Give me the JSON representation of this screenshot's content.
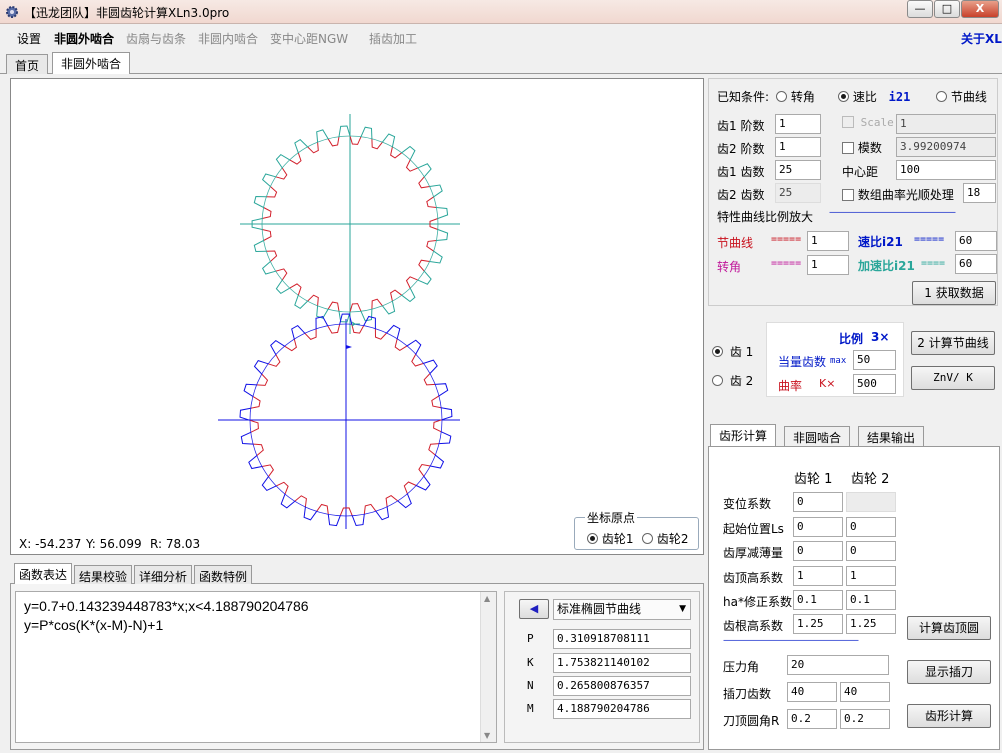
{
  "window": {
    "title": "【迅龙团队】非圆齿轮计算XLn3.0pro",
    "minimize": "—",
    "maximize": "□",
    "close": "X"
  },
  "menu": {
    "items": [
      "设置",
      "非圆外啮合",
      "齿扇与齿条",
      "非圆内啮合",
      "变中心距NGW",
      "插齿加工"
    ],
    "about": "关于XL"
  },
  "tabs": [
    "首页",
    "非圆外啮合"
  ],
  "canvas": {
    "x_label": "X: -54.237",
    "y_label": "Y: 56.099",
    "r_label": "R: 78.03",
    "origin_title": "坐标原点",
    "origin_gear1": "齿轮1",
    "origin_gear2": "齿轮2",
    "gear1_color": "#2aa69a",
    "gear2_color": "#1010e6",
    "flank_color": "#d2202c"
  },
  "known": {
    "label": "已知条件:",
    "opt_angle": "转角",
    "opt_speed": "速比",
    "speed_tag": "i21",
    "opt_pitch": "节曲线"
  },
  "params": {
    "g1_order_label": "齿1 阶数",
    "g1_order": "1",
    "g2_order_label": "齿2 阶数",
    "g2_order": "1",
    "g1_teeth_label": "齿1 齿数",
    "g1_teeth": "25",
    "g2_teeth_label": "齿2 齿数",
    "g2_teeth": "25",
    "scale_label": "Scale",
    "scale": "1",
    "module_label": "模数",
    "module": "3.99200974",
    "center_label": "中心距",
    "center": "100",
    "smooth_label": "数组曲率光顺处理",
    "smooth": "18"
  },
  "curve_scale": {
    "title": "特性曲线比例放大",
    "dashes": "——————————————",
    "pitch_label": "节曲线",
    "pitch_eq": "=====",
    "pitch_val": "1",
    "speed_label": "速比i21",
    "speed_eq": "=====",
    "speed_val": "60",
    "angle_label": "转角",
    "angle_eq": "=====",
    "angle_val": "1",
    "accel_label": "加速比i21",
    "accel_eq": "====",
    "accel_val": "60",
    "get_data_btn": "1 获取数据"
  },
  "mid": {
    "gear1": "齿 1",
    "gear2": "齿 2",
    "ratio_label": "比例",
    "ratio_val": "3×",
    "equiv_label": "当量齿数",
    "max_label": "max",
    "equiv_val": "50",
    "curv_label": "曲率",
    "k_label": "K×",
    "curv_val": "500",
    "calc_pitch_btn": "2 计算节曲线",
    "znv_btn": "ZnV/ K"
  },
  "tooth": {
    "tabs": [
      "齿形计算",
      "非圆啮合",
      "结果输出"
    ],
    "col1": "齿轮 1",
    "col2": "齿轮 2",
    "rows": [
      {
        "label": "变位系数",
        "v1": "0",
        "v2": ""
      },
      {
        "label": "起始位置Ls",
        "v1": "0",
        "v2": "0"
      },
      {
        "label": "齿厚减薄量",
        "v1": "0",
        "v2": "0"
      },
      {
        "label": "齿顶高系数",
        "v1": "1",
        "v2": "1"
      },
      {
        "label": "ha*修正系数",
        "v1": "0.1",
        "v2": "0.1"
      },
      {
        "label": "齿根高系数",
        "v1": "1.25",
        "v2": "1.25"
      }
    ],
    "dashes": "———————————————",
    "pressure_label": "压力角",
    "pressure": "20",
    "cutter_label": "插刀齿数",
    "cutter1": "40",
    "cutter2": "40",
    "radius_label": "刀顶圆角R",
    "radius1": "0.2",
    "radius2": "0.2",
    "btn_tip": "计算齿顶圆",
    "btn_show": "显示插刀",
    "btn_calc": "齿形计算"
  },
  "bottom": {
    "tabs": [
      "函数表达",
      "结果校验",
      "详细分析",
      "函数特例"
    ],
    "expr1": "y=0.7+0.143239448783*x;x<4.188790204786",
    "expr2": "y=P*cos(K*(x-M)-N)+1",
    "curve_select": "标准椭圆节曲线",
    "arrow": "◀",
    "params": [
      {
        "name": "P",
        "value": "0.310918708111"
      },
      {
        "name": "K",
        "value": "1.753821140102"
      },
      {
        "name": "N",
        "value": "0.265800876357"
      },
      {
        "name": "M",
        "value": "4.188790204786"
      }
    ]
  }
}
